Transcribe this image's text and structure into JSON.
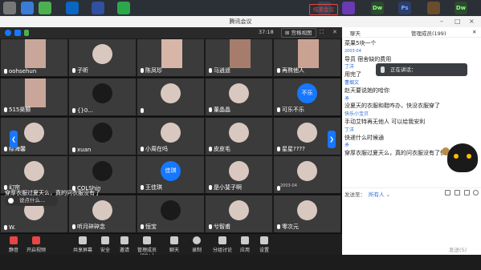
{
  "window": {
    "title": "腾讯会议"
  },
  "meeting": {
    "timer": "37:18",
    "view_label": "⊞ 宫格视图"
  },
  "tiles": [
    {
      "name": "oohsehun",
      "avatar": "photo"
    },
    {
      "name": "子昕",
      "avatar": "normal"
    },
    {
      "name": "陈凤珍",
      "avatar": "photo"
    },
    {
      "name": "马逍遥",
      "avatar": "photo"
    },
    {
      "name": "再熬他人",
      "avatar": "photo"
    },
    {
      "name": "515昊颢",
      "avatar": "photo"
    },
    {
      "name": "{}0...",
      "avatar": "dark"
    },
    {
      "name": "",
      "avatar": "normal"
    },
    {
      "name": "董晶晶",
      "avatar": "normal"
    },
    {
      "name": "可乐不乐",
      "avatar": "blue",
      "avatar_text": "不乐"
    },
    {
      "name": "缪海馨",
      "avatar": "normal"
    },
    {
      "name": "xuan",
      "avatar": "dark"
    },
    {
      "name": "小周在吗",
      "avatar": "normal"
    },
    {
      "name": "皮皮毛",
      "avatar": "normal"
    },
    {
      "name": "星星????",
      "avatar": "normal"
    },
    {
      "name": "幻帘",
      "avatar": "normal"
    },
    {
      "name": "COLShin",
      "avatar": "dark"
    },
    {
      "name": "王佳琪",
      "avatar": "blue",
      "avatar_text": "佳琪"
    },
    {
      "name": "是小斐子啊",
      "avatar": "normal"
    },
    {
      "name": "",
      "avatar": "normal",
      "time": "2003-04"
    },
    {
      "name": "W.",
      "avatar": "normal"
    },
    {
      "name": "听月碎碎念",
      "avatar": "normal"
    },
    {
      "name": "恒宝",
      "avatar": "dark"
    },
    {
      "name": "兮智甫",
      "avatar": "normal"
    },
    {
      "name": "零次元",
      "avatar": "normal"
    }
  ],
  "bullet": "穿厚衣服过夏天么，真的问衣服没有了",
  "speak_pill": "说点什么...",
  "toolbar": [
    {
      "label": "静音",
      "icon": "mic-off-icon"
    },
    {
      "label": "开启视频",
      "icon": "camera-off-icon"
    },
    {
      "label": "共享屏幕",
      "icon": "share-screen-icon"
    },
    {
      "label": "安全",
      "icon": "shield-icon"
    },
    {
      "label": "邀请",
      "icon": "invite-icon"
    },
    {
      "label": "管理成员(99+)",
      "icon": "members-icon"
    },
    {
      "label": "聊天",
      "icon": "chat-icon"
    },
    {
      "label": "录制",
      "icon": "record-icon"
    },
    {
      "label": "分组讨论",
      "icon": "group-icon"
    },
    {
      "label": "应用",
      "icon": "apps-icon"
    },
    {
      "label": "设置",
      "icon": "gear-icon"
    }
  ],
  "leave_label": "结束会议",
  "chat": {
    "tab_chat": "聊天",
    "tab_members": "管理成员(199)",
    "speaking": "正在讲话：",
    "messages": [
      {
        "t": "text",
        "v": "菜果5块一个"
      },
      {
        "t": "ts",
        "v": "2003-04"
      },
      {
        "t": "text",
        "v": "导员  宿舍缺的费用"
      },
      {
        "t": "nm",
        "v": "丁洋"
      },
      {
        "t": "text",
        "v": "用完了"
      },
      {
        "t": "nm",
        "v": "曹烟文"
      },
      {
        "t": "text",
        "v": "赵天要说她的哈你"
      },
      {
        "t": "nm",
        "v": "矛"
      },
      {
        "t": "text",
        "v": "没夏天的衣服和鞋咋办，快没衣服穿了"
      },
      {
        "t": "nm",
        "v": "快乐小宝贝"
      },
      {
        "t": "text",
        "v": "手动艾特再无他人 可以给我安利"
      },
      {
        "t": "nm",
        "v": "丁洋"
      },
      {
        "t": "text",
        "v": "快递什么时候通"
      },
      {
        "t": "nm",
        "v": "矛"
      },
      {
        "t": "text",
        "v": "穿厚衣服过夏天么，真的问衣服没有了快"
      }
    ],
    "send_to_label": "发送至：",
    "send_to_target": "所有人 ⌄",
    "send_button": "发送(S)"
  },
  "colors": {
    "accent": "#1677ff",
    "danger": "#e94545",
    "name_blue": "#2d6bd8"
  }
}
